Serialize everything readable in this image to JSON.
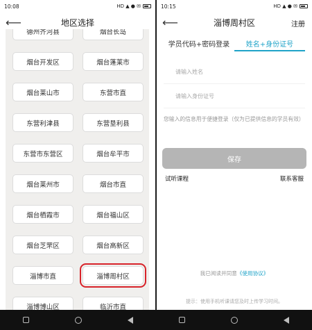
{
  "left": {
    "status": {
      "time": "10:08",
      "icons": "HD ▲ ● ✉"
    },
    "title": "地区选择",
    "cities": [
      "德州齐河县",
      "烟台长岛",
      "烟台开发区",
      "烟台蓬莱市",
      "烟台莱山市",
      "东营市直",
      "东营利津县",
      "东营垦利县",
      "东营市东营区",
      "烟台牟平市",
      "烟台莱州市",
      "烟台市直",
      "烟台栖霞市",
      "烟台福山区",
      "烟台芝罘区",
      "烟台高新区",
      "淄博市直",
      "淄博周村区",
      "淄博博山区",
      "临沂市直"
    ],
    "selected": "淄博周村区"
  },
  "right": {
    "status": {
      "time": "10:15",
      "icons": "HD ▲ ● ✉"
    },
    "title": "淄博周村区",
    "register": "注册",
    "tabs": [
      "学员代码+密码登录",
      "姓名+身份证号"
    ],
    "active_tab": 1,
    "name_placeholder": "请输入姓名",
    "id_placeholder": "请输入身份证号",
    "note": "您输入的信息用于便捷登录（仅为已提供信息的学员有效）",
    "save": "保存",
    "trial": "试听课程",
    "service": "联系客服",
    "agree_prefix": "我已阅读并同意",
    "agree_link": "《使用协议》",
    "tip": "提示：使用手机听课请您及时上传学习时间。"
  }
}
